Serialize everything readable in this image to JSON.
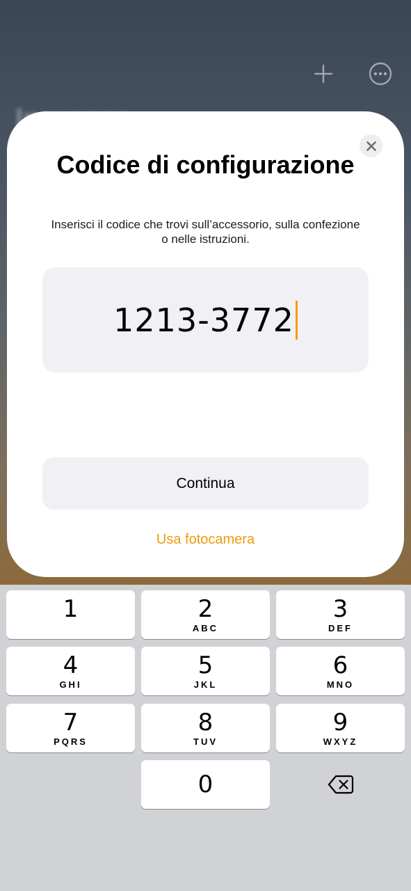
{
  "modal": {
    "title": "Codice di configurazione",
    "subtitle": "Inserisci il codice che trovi sull’accessorio, sulla confezione o nelle istruzioni.",
    "code_value": "1213-3772",
    "continue_label": "Continua",
    "camera_label": "Usa fotocamera",
    "accent_color": "#f09a12"
  },
  "background": {
    "plus_icon": "plus-icon",
    "more_icon": "ellipsis-circle-icon"
  },
  "keypad": {
    "keys": [
      {
        "digit": "1",
        "letters": ""
      },
      {
        "digit": "2",
        "letters": "ABC"
      },
      {
        "digit": "3",
        "letters": "DEF"
      },
      {
        "digit": "4",
        "letters": "GHI"
      },
      {
        "digit": "5",
        "letters": "JKL"
      },
      {
        "digit": "6",
        "letters": "MNO"
      },
      {
        "digit": "7",
        "letters": "PQRS"
      },
      {
        "digit": "8",
        "letters": "TUV"
      },
      {
        "digit": "9",
        "letters": "WXYZ"
      },
      {
        "digit": "0",
        "letters": ""
      }
    ],
    "backspace_icon": "delete-backward-icon"
  }
}
